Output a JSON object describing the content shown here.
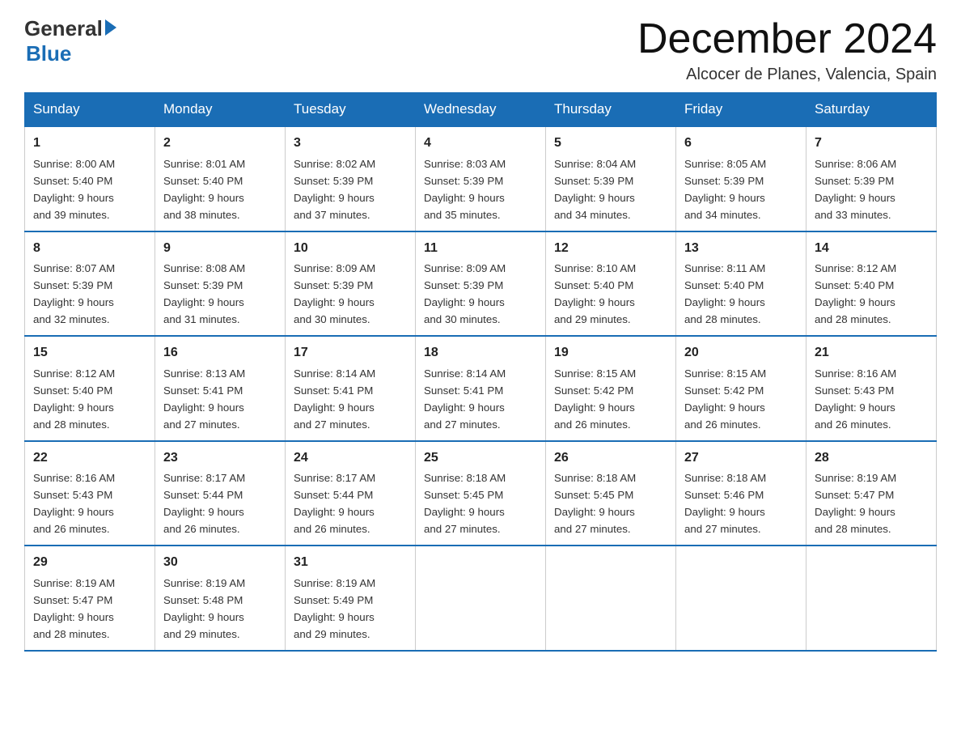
{
  "header": {
    "logo_general": "General",
    "logo_blue": "Blue",
    "month_title": "December 2024",
    "location": "Alcocer de Planes, Valencia, Spain"
  },
  "days_of_week": [
    "Sunday",
    "Monday",
    "Tuesday",
    "Wednesday",
    "Thursday",
    "Friday",
    "Saturday"
  ],
  "weeks": [
    [
      {
        "day": "1",
        "sunrise": "8:00 AM",
        "sunset": "5:40 PM",
        "daylight": "9 hours and 39 minutes."
      },
      {
        "day": "2",
        "sunrise": "8:01 AM",
        "sunset": "5:40 PM",
        "daylight": "9 hours and 38 minutes."
      },
      {
        "day": "3",
        "sunrise": "8:02 AM",
        "sunset": "5:39 PM",
        "daylight": "9 hours and 37 minutes."
      },
      {
        "day": "4",
        "sunrise": "8:03 AM",
        "sunset": "5:39 PM",
        "daylight": "9 hours and 35 minutes."
      },
      {
        "day": "5",
        "sunrise": "8:04 AM",
        "sunset": "5:39 PM",
        "daylight": "9 hours and 34 minutes."
      },
      {
        "day": "6",
        "sunrise": "8:05 AM",
        "sunset": "5:39 PM",
        "daylight": "9 hours and 34 minutes."
      },
      {
        "day": "7",
        "sunrise": "8:06 AM",
        "sunset": "5:39 PM",
        "daylight": "9 hours and 33 minutes."
      }
    ],
    [
      {
        "day": "8",
        "sunrise": "8:07 AM",
        "sunset": "5:39 PM",
        "daylight": "9 hours and 32 minutes."
      },
      {
        "day": "9",
        "sunrise": "8:08 AM",
        "sunset": "5:39 PM",
        "daylight": "9 hours and 31 minutes."
      },
      {
        "day": "10",
        "sunrise": "8:09 AM",
        "sunset": "5:39 PM",
        "daylight": "9 hours and 30 minutes."
      },
      {
        "day": "11",
        "sunrise": "8:09 AM",
        "sunset": "5:39 PM",
        "daylight": "9 hours and 30 minutes."
      },
      {
        "day": "12",
        "sunrise": "8:10 AM",
        "sunset": "5:40 PM",
        "daylight": "9 hours and 29 minutes."
      },
      {
        "day": "13",
        "sunrise": "8:11 AM",
        "sunset": "5:40 PM",
        "daylight": "9 hours and 28 minutes."
      },
      {
        "day": "14",
        "sunrise": "8:12 AM",
        "sunset": "5:40 PM",
        "daylight": "9 hours and 28 minutes."
      }
    ],
    [
      {
        "day": "15",
        "sunrise": "8:12 AM",
        "sunset": "5:40 PM",
        "daylight": "9 hours and 28 minutes."
      },
      {
        "day": "16",
        "sunrise": "8:13 AM",
        "sunset": "5:41 PM",
        "daylight": "9 hours and 27 minutes."
      },
      {
        "day": "17",
        "sunrise": "8:14 AM",
        "sunset": "5:41 PM",
        "daylight": "9 hours and 27 minutes."
      },
      {
        "day": "18",
        "sunrise": "8:14 AM",
        "sunset": "5:41 PM",
        "daylight": "9 hours and 27 minutes."
      },
      {
        "day": "19",
        "sunrise": "8:15 AM",
        "sunset": "5:42 PM",
        "daylight": "9 hours and 26 minutes."
      },
      {
        "day": "20",
        "sunrise": "8:15 AM",
        "sunset": "5:42 PM",
        "daylight": "9 hours and 26 minutes."
      },
      {
        "day": "21",
        "sunrise": "8:16 AM",
        "sunset": "5:43 PM",
        "daylight": "9 hours and 26 minutes."
      }
    ],
    [
      {
        "day": "22",
        "sunrise": "8:16 AM",
        "sunset": "5:43 PM",
        "daylight": "9 hours and 26 minutes."
      },
      {
        "day": "23",
        "sunrise": "8:17 AM",
        "sunset": "5:44 PM",
        "daylight": "9 hours and 26 minutes."
      },
      {
        "day": "24",
        "sunrise": "8:17 AM",
        "sunset": "5:44 PM",
        "daylight": "9 hours and 26 minutes."
      },
      {
        "day": "25",
        "sunrise": "8:18 AM",
        "sunset": "5:45 PM",
        "daylight": "9 hours and 27 minutes."
      },
      {
        "day": "26",
        "sunrise": "8:18 AM",
        "sunset": "5:45 PM",
        "daylight": "9 hours and 27 minutes."
      },
      {
        "day": "27",
        "sunrise": "8:18 AM",
        "sunset": "5:46 PM",
        "daylight": "9 hours and 27 minutes."
      },
      {
        "day": "28",
        "sunrise": "8:19 AM",
        "sunset": "5:47 PM",
        "daylight": "9 hours and 28 minutes."
      }
    ],
    [
      {
        "day": "29",
        "sunrise": "8:19 AM",
        "sunset": "5:47 PM",
        "daylight": "9 hours and 28 minutes."
      },
      {
        "day": "30",
        "sunrise": "8:19 AM",
        "sunset": "5:48 PM",
        "daylight": "9 hours and 29 minutes."
      },
      {
        "day": "31",
        "sunrise": "8:19 AM",
        "sunset": "5:49 PM",
        "daylight": "9 hours and 29 minutes."
      },
      null,
      null,
      null,
      null
    ]
  ],
  "labels": {
    "sunrise": "Sunrise:",
    "sunset": "Sunset:",
    "daylight": "Daylight:"
  }
}
